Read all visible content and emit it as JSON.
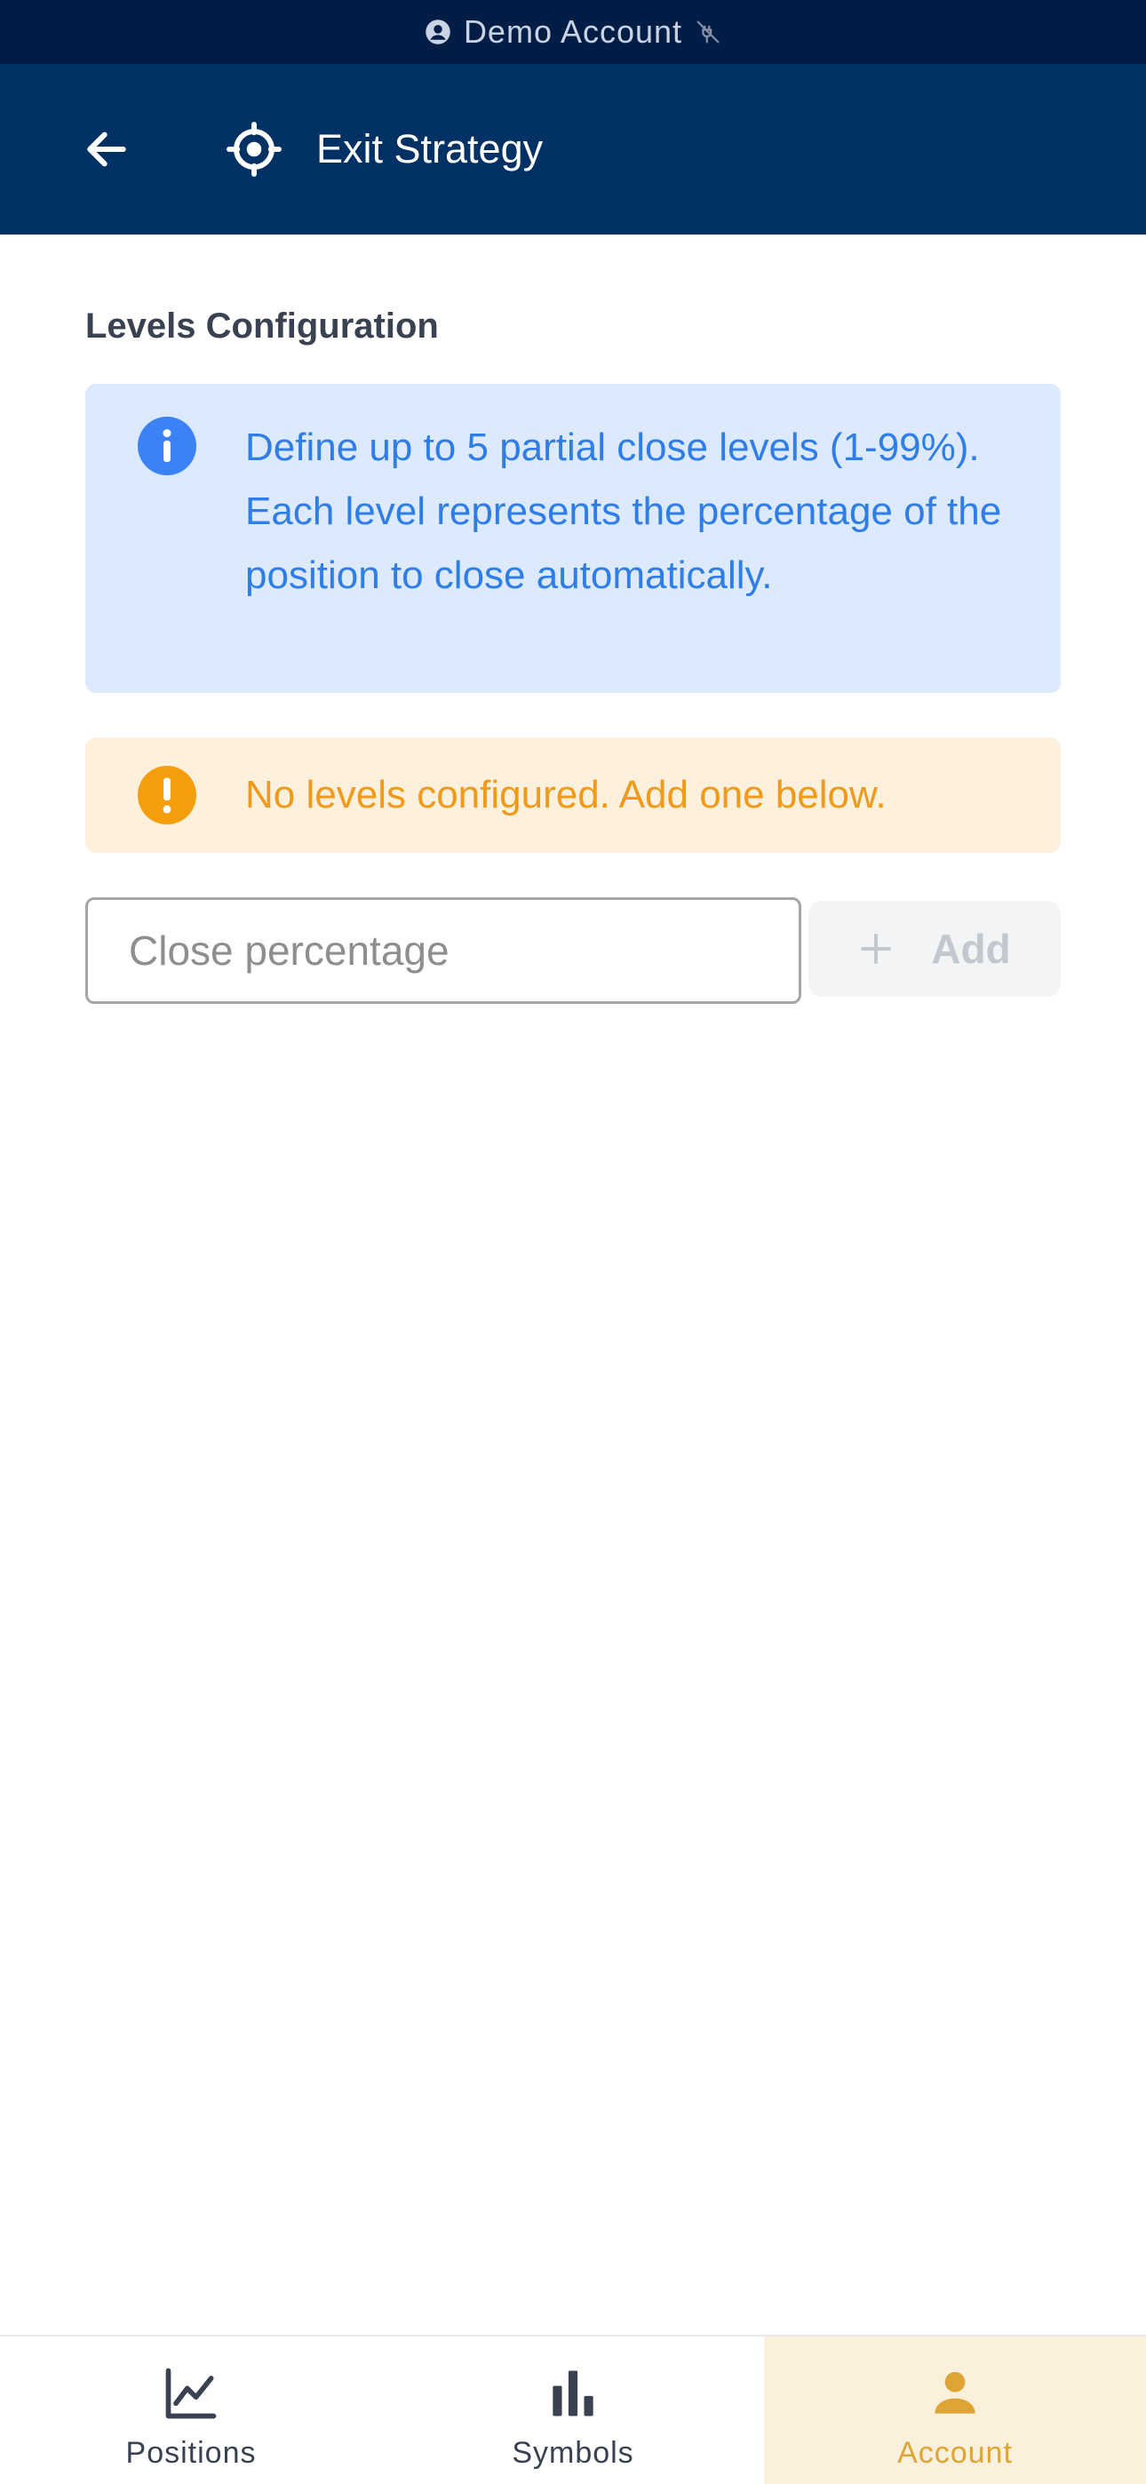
{
  "status_strip": {
    "account_label": "Demo Account",
    "account_icon": "account-circle-icon",
    "connection_icon": "disconnected-plug-icon"
  },
  "header": {
    "back_icon": "arrow-left-icon",
    "title_icon": "crosshair-icon",
    "title": "Exit Strategy"
  },
  "levels": {
    "section_title": "Levels Configuration",
    "info_message": "Define up to 5 partial close levels (1-99%). Each level represents the percentage of the position to close automatically.",
    "warning_message": "No levels configured. Add one below.",
    "input_placeholder": "Close percentage",
    "input_value": "",
    "add_label": "Add"
  },
  "bottom_nav": {
    "items": [
      {
        "label": "Positions",
        "icon": "line-chart-icon",
        "active": false
      },
      {
        "label": "Symbols",
        "icon": "bar-chart-icon",
        "active": false
      },
      {
        "label": "Account",
        "icon": "person-icon",
        "active": true
      }
    ]
  },
  "colors": {
    "status_strip_bg": "#001e45",
    "header_bg": "#003164",
    "info_bg": "#dde9fc",
    "info_fg": "#2e7de9",
    "warning_bg": "#fdf0dc",
    "warning_fg": "#f19a1a",
    "nav_active_bg": "#fbf0dc",
    "nav_active_fg": "#dea535"
  }
}
